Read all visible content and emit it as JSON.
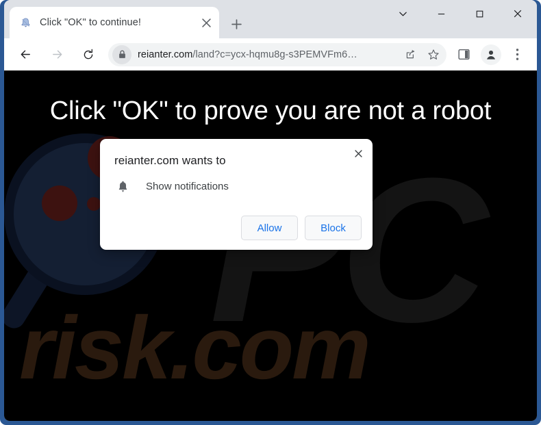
{
  "window": {
    "frame_color": "#2b5894",
    "chrome_color": "#dee1e6",
    "controls": [
      {
        "name": "tab-search",
        "glyph": "chevron-down"
      },
      {
        "name": "minimize",
        "glyph": "minimize"
      },
      {
        "name": "maximize",
        "glyph": "maximize"
      },
      {
        "name": "close",
        "glyph": "close"
      }
    ]
  },
  "tab": {
    "title": "Click \"OK\" to continue!",
    "favicon": "bell-icon",
    "close_label": "×",
    "new_tab_label": "+"
  },
  "toolbar": {
    "back_icon": "arrow-left-icon",
    "forward_icon": "arrow-right-icon",
    "reload_icon": "reload-icon",
    "site_info_icon": "lock-icon",
    "url_host": "reianter.com",
    "url_path": "/land?c=ycx-hqmu8g-s3PEMVFm6…",
    "url_full": "reianter.com/land?c=ycx-hqmu8g-s3PEMVFm6…",
    "share_icon": "share-icon",
    "bookmark_icon": "star-icon",
    "side_panel_icon": "side-panel-icon",
    "profile_icon": "avatar-icon",
    "menu_icon": "three-dot-menu-icon"
  },
  "page": {
    "background": "#000000",
    "heading": "Click \"OK\" to prove you are not a robot",
    "heading_color": "#ffffff",
    "watermark_pc": "PC",
    "watermark_risk": "risk.com",
    "watermark_pc_color": "#141414",
    "watermark_risk_color": "#2a1a0e",
    "graphic": "magnifier-germs-illustration"
  },
  "dialog": {
    "title": "reianter.com wants to",
    "permission_icon": "bell-icon",
    "permission_label": "Show notifications",
    "close_label": "×",
    "allow_label": "Allow",
    "block_label": "Block",
    "button_text_color": "#1a73e8"
  }
}
